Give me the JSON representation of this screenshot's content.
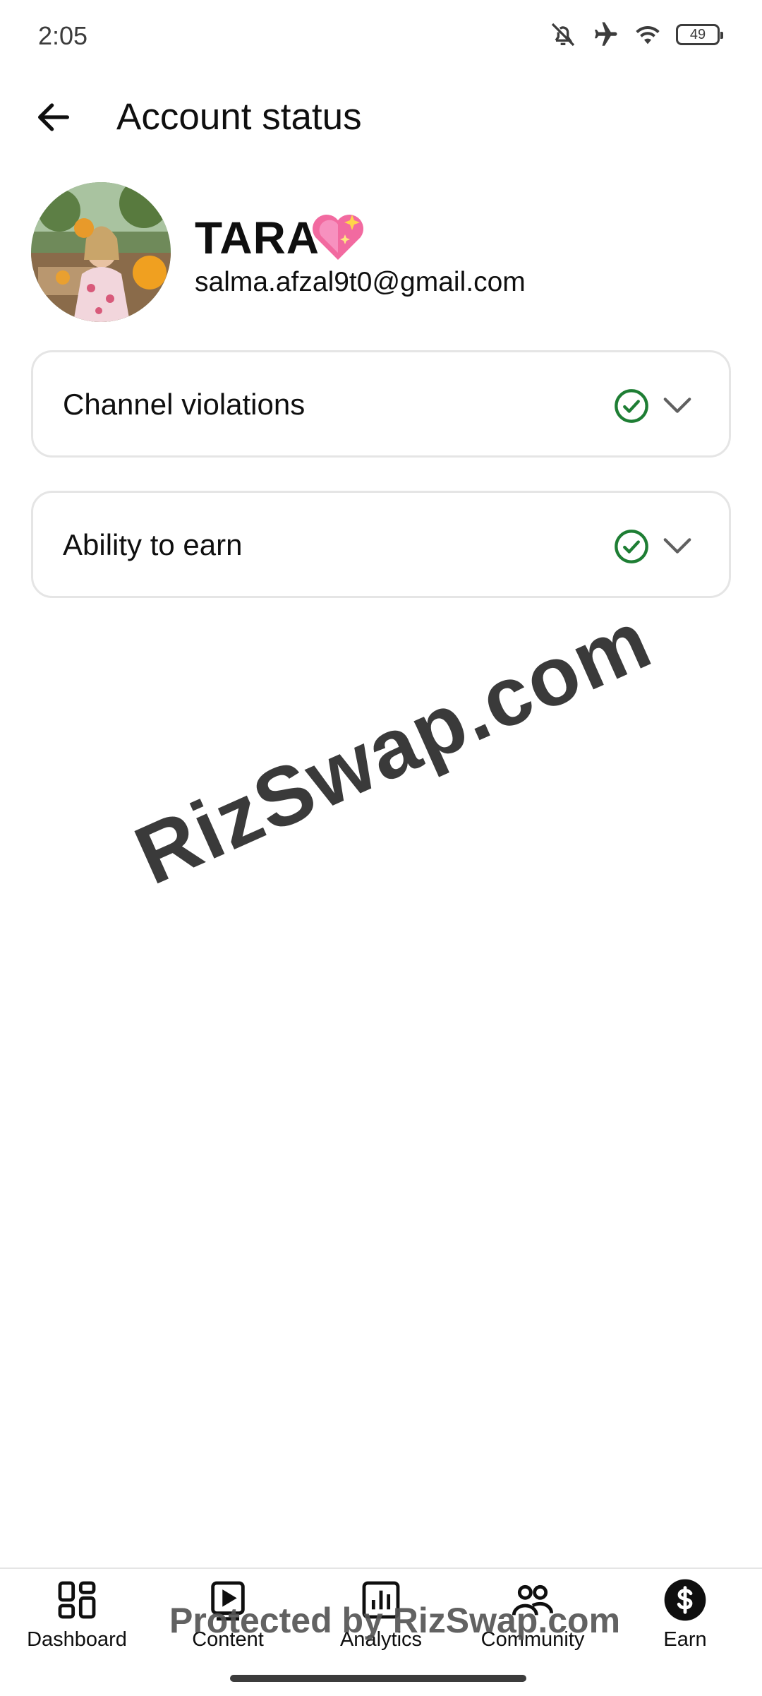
{
  "status_bar": {
    "time": "2:05",
    "icons": [
      "bell-off-icon",
      "airplane-icon",
      "wifi-icon",
      "battery-icon"
    ],
    "battery_level": "49"
  },
  "header": {
    "back_icon": "arrow-left-icon",
    "title": "Account status"
  },
  "profile": {
    "name": "TARA",
    "emoji": "sparkling-heart",
    "email": "salma.afzal9t0@gmail.com"
  },
  "cards": [
    {
      "label": "Channel violations",
      "status_icon": "check-circle-icon",
      "status_color": "#1e7e34",
      "expand_icon": "chevron-down-icon"
    },
    {
      "label": "Ability to earn",
      "status_icon": "check-circle-icon",
      "status_color": "#1e7e34",
      "expand_icon": "chevron-down-icon"
    }
  ],
  "watermark": {
    "text": "RizSwap.com",
    "footer_text": "Protected by RizSwap.com"
  },
  "bottom_nav": {
    "items": [
      {
        "label": "Dashboard",
        "icon": "dashboard-icon"
      },
      {
        "label": "Content",
        "icon": "content-icon"
      },
      {
        "label": "Analytics",
        "icon": "analytics-icon"
      },
      {
        "label": "Community",
        "icon": "community-icon"
      },
      {
        "label": "Earn",
        "icon": "dollar-icon",
        "selected": true
      }
    ]
  }
}
